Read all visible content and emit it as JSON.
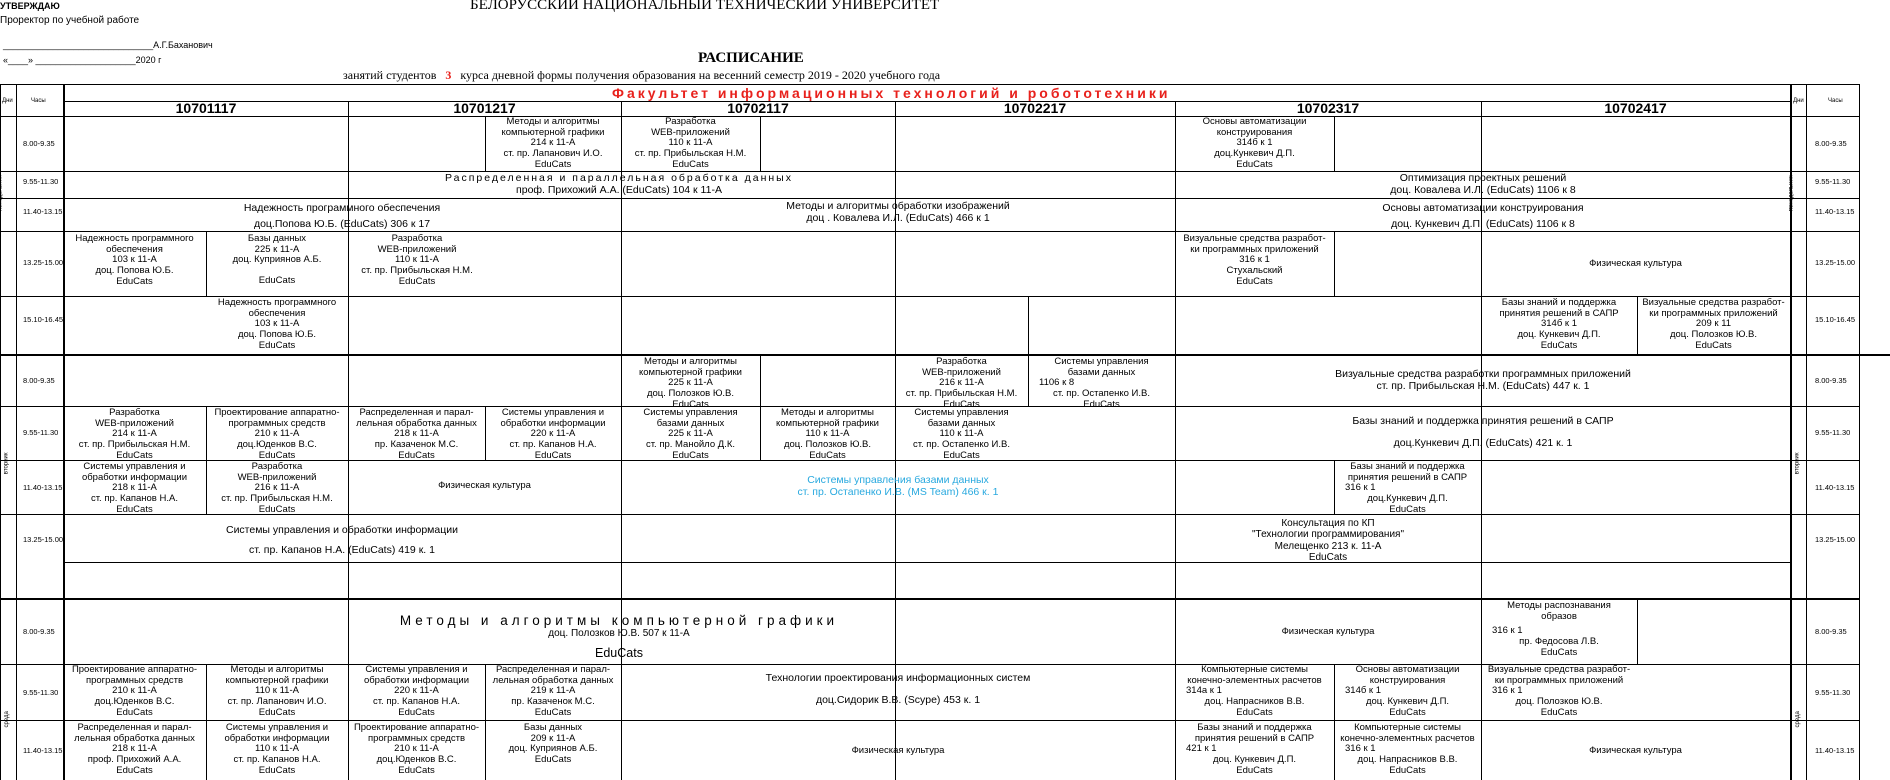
{
  "header": {
    "approve": "УТВЕРЖДАЮ",
    "prorector": "Проректор по учебной работе",
    "signature_line": "______________________________А.Г.Баханович",
    "date_line": "«____» ____________________2020 г",
    "university": "БЕЛОРУССКИЙ НАЦИОНАЛЬНЫЙ ТЕХНИЧЕСКИЙ УНИВЕРСИТЕТ",
    "title": "РАСПИСАНИЕ",
    "subtitle_pre": "занятий студентов",
    "course": "3",
    "subtitle_post": "курса  дневной формы получения образования на весенний семестр  2019 - 2020 учебного года",
    "faculty": "Факультет  информационных  технологий  и  робототехники",
    "col_day": "Дни",
    "col_hours": "Часы"
  },
  "groups": [
    "10701117",
    "10701217",
    "10702117",
    "10702217",
    "10702317",
    "10702417"
  ],
  "days": [
    "понедельник",
    "вторник",
    "среда"
  ],
  "times": [
    "8.00-9.35",
    "9.55-11.30",
    "11.40-13.15",
    "13.25-15.00",
    "15.10-16.45",
    "8.00-9.35",
    "9.55-11.30",
    "11.40-13.15",
    "13.25-15.00",
    "8.00-9.35",
    "9.55-11.30",
    "11.40-13.15"
  ],
  "cells": [
    {
      "lines": [
        "Методы и алгоритмы",
        "компьютерной графики",
        "214  к 11-А",
        "ст. пр. Лапанович И.О.",
        "EduCats"
      ]
    },
    {
      "lines": [
        "Разработка",
        "WEB-приложений",
        "110  к 11-А",
        "ст. пр. Прибыльская Н.М.",
        "EduCats"
      ]
    },
    {
      "lines": [
        "Основы автоматизации",
        "конструирования",
        "314б  к 1",
        "доц.Кункевич Д.П.",
        "EduCats"
      ]
    },
    {
      "lines": [
        "Распределенная   и   параллельная   обработка   данных",
        "проф. Прихожий А.А.  (EduCats)  104  к 11-А"
      ]
    },
    {
      "lines": [
        "Оптимизация  проектных  решений",
        "доц. Ковалева И.Л.   (EduCats)     1106 к 8"
      ]
    },
    {
      "lines": [
        "Надежность программного обеспечения",
        "доц.Попова Ю.Б. (EduCats) 306 к 17"
      ]
    },
    {
      "lines": [
        "Методы и алгоритмы обработки изображений",
        "доц . Ковалева И.Л. (EduCats) 466  к 1"
      ]
    },
    {
      "lines": [
        "Основы автоматизации конструирования",
        "доц. Кункевич Д.П. (EduCats) 1106 к 8"
      ]
    },
    {
      "lines": [
        "Надежность программного",
        "обеспечения",
        "103  к 11-А",
        "доц.   Попова Ю.Б.",
        "EduCats"
      ]
    },
    {
      "lines": [
        "Базы данных",
        "225  к 11-А",
        "доц. Куприянов А.Б.",
        "EduCats"
      ]
    },
    {
      "lines": [
        "Разработка",
        "WEB-приложений",
        "110  к 11-А",
        "ст. пр. Прибыльская Н.М.",
        "EduCats"
      ]
    },
    {
      "lines": [
        "Визуальные средства разработ-",
        "ки программных приложений",
        "316  к 1",
        "Стухальский",
        "EduCats"
      ]
    },
    {
      "lines": [
        "Физическая культура"
      ]
    },
    {
      "lines": [
        "Надежность программного",
        "обеспечения",
        "103  к 11-А",
        "доц.   Попова Ю.Б.",
        "EduCats"
      ]
    },
    {
      "lines": [
        "Базы знаний и поддержка",
        "принятия решений в САПР",
        "314б  к 1",
        "доц. Кункевич Д.П.",
        "EduCats"
      ]
    },
    {
      "lines": [
        "Визуальные средства разработ-",
        "ки программных приложений",
        "209  к 11",
        "доц. Полозков Ю.В.",
        "EduCats"
      ]
    },
    {
      "lines": [
        "Методы и алгоритмы",
        "компьютерной графики",
        "225  к 11-А",
        "доц. Полозков Ю.В.",
        "EduCats"
      ]
    },
    {
      "lines": [
        "Разработка",
        "WEB-приложений",
        "216  к 11-А",
        "ст. пр. Прибыльская Н.М.",
        "EduCats"
      ]
    },
    {
      "lines": [
        "Системы управления",
        "базами данных",
        "1106 к 8",
        "ст. пр. Остапенко И.В.",
        "EduCats"
      ]
    },
    {
      "lines": [
        "Визуальные средства разработки программных приложений",
        "ст. пр. Прибыльская Н.М. (EduCats) 447 к. 1"
      ]
    },
    {
      "lines": [
        "Разработка",
        "WEB-приложений",
        "214  к 11-А",
        "ст. пр. Прибыльская Н.М.",
        "EduCats"
      ]
    },
    {
      "lines": [
        "Проектирование аппаратно-",
        "программных средств",
        "210  к 11-А",
        "доц.Юденков В.С.",
        "EduCats"
      ]
    },
    {
      "lines": [
        "Распределенная и парал-",
        "лельная обработка данных",
        "218   к 11-А",
        "пр. Казаченок М.С.",
        "EduCats"
      ]
    },
    {
      "lines": [
        "Системы управления и",
        "обработки информации",
        "220  к 11-А",
        "ст. пр. Капанов Н.А.",
        "EduCats"
      ]
    },
    {
      "lines": [
        "Системы управления",
        "базами данных",
        "225  к 11-А",
        "ст. пр. Манойло Д.К.",
        "EduCats"
      ]
    },
    {
      "lines": [
        "Методы и алгоритмы",
        "компьютерной графики",
        "110  к 11-А",
        "доц. Полозков Ю.В.",
        "EduCats"
      ]
    },
    {
      "lines": [
        "Системы управления",
        "базами данных",
        "110  к 11-А",
        "ст. пр. Остапенко И.В.",
        "EduCats"
      ]
    },
    {
      "lines": [
        "Базы знаний и поддержка принятия решений в САПР",
        "доц.Кункевич Д.П. (EduCats)  421  к. 1"
      ]
    },
    {
      "lines": [
        "Системы управления и",
        "обработки информации",
        "218  к 11-А",
        "ст. пр. Капанов Н.А.",
        "EduCats"
      ]
    },
    {
      "lines": [
        "Разработка",
        "WEB-приложений",
        "216  к 11-А",
        "ст. пр. Прибыльская Н.М.",
        "EduCats"
      ]
    },
    {
      "lines": [
        "Физическая культура"
      ]
    },
    {
      "lines": [
        "Системы управления базами данных",
        "ст. пр. Остапенко И.В. (MS Team) 466  к. 1"
      ]
    },
    {
      "lines": [
        "Базы знаний и поддержка",
        "принятия решений в САПР",
        "316  к 1",
        "доц.Кункевич Д.П.",
        "EduCats"
      ]
    },
    {
      "lines": [
        "Системы управления и обработки информации",
        "ст. пр. Капанов Н.А. (EduCats) 419 к. 1"
      ]
    },
    {
      "lines": [
        "Консультация по КП",
        "\"Технологии программирования\"",
        "Мелещенко 213 к. 11-А",
        "EduCats"
      ]
    },
    {
      "lines": [
        "Методы   и   алгоритмы   компьютерной   графики",
        "доц. Полозков Ю.В. 507 к 11-А",
        "EduCats"
      ]
    },
    {
      "lines": [
        "Физическая культура"
      ]
    },
    {
      "lines": [
        "Методы распознавания",
        "образов",
        "316  к 1",
        "пр. Федосова  Л.В.",
        "EduCats"
      ]
    },
    {
      "lines": [
        "Проектирование аппаратно-",
        "программных средств",
        "210  к 11-А",
        "доц.Юденков В.С.",
        "EduCats"
      ]
    },
    {
      "lines": [
        "Методы и алгоритмы",
        "компьютерной графики",
        "110  к 11-А",
        "ст. пр. Лапанович И.О.",
        "EduCats"
      ]
    },
    {
      "lines": [
        "Системы управления и",
        "обработки информации",
        "220  к 11-А",
        "ст. пр. Капанов Н.А.",
        "EduCats"
      ]
    },
    {
      "lines": [
        "Распределенная и парал-",
        "лельная обработка данных",
        "219   к 11-А",
        "пр. Казаченок М.С.",
        "EduCats"
      ]
    },
    {
      "lines": [
        "Технологии проектирования информационных систем",
        "доц.Сидорик В.В. (Scype)  453 к. 1"
      ]
    },
    {
      "lines": [
        "Компьютерные системы",
        "конечно-элементных расчетов",
        "314а к 1",
        "доц. Напрасников В.В.",
        "EduCats"
      ]
    },
    {
      "lines": [
        "Основы автоматизации",
        "конструирования",
        "314б к 1",
        "доц. Кункевич Д.П.",
        "EduCats"
      ]
    },
    {
      "lines": [
        "Визуальные средства разработ-",
        "ки программных приложений",
        "316  к 1",
        "доц. Полозков Ю.В.",
        "EduCats"
      ]
    },
    {
      "lines": [
        "Распределенная и парал-",
        "лельная обработка данных",
        "218   к 11-А",
        "проф. Прихожий А.А.",
        "EduCats"
      ]
    },
    {
      "lines": [
        "Системы управления и",
        "обработки информации",
        "110  к 11-А",
        "ст. пр. Капанов Н.А.",
        "EduCats"
      ]
    },
    {
      "lines": [
        "Проектирование аппаратно-",
        "программных средств",
        "210  к 11-А",
        "доц.Юденков В.С.",
        "EduCats"
      ]
    },
    {
      "lines": [
        "Базы данных",
        "",
        "209  к 11-А",
        "доц. Куприянов А.Б.",
        "EduCats"
      ]
    },
    {
      "lines": [
        "Физическая культура"
      ]
    },
    {
      "lines": [
        "Базы знаний и поддержка",
        "принятия решений в САПР",
        "421  к 1",
        "доц. Кункевич Д.П.",
        "EduCats"
      ]
    },
    {
      "lines": [
        "Компьютерные системы",
        "конечно-элементных расчетов",
        "316  к 1",
        "доц. Напрасников В.В.",
        "EduCats"
      ]
    },
    {
      "lines": [
        "Физическая культура"
      ]
    }
  ],
  "colors": {
    "faculty": "#e8211c",
    "course": "#e8211c",
    "remote": "#29a9df",
    "grid": "#000000"
  }
}
